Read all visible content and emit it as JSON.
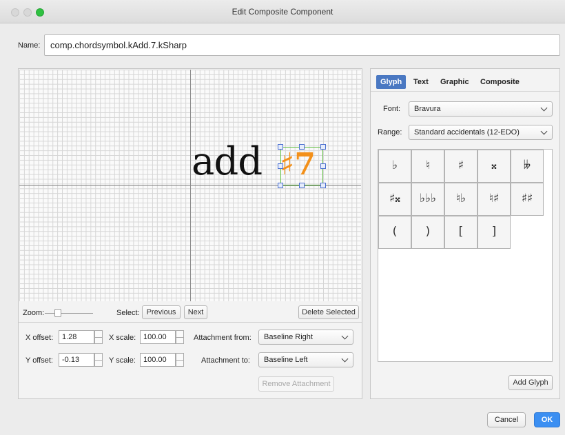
{
  "window": {
    "title": "Edit Composite Component"
  },
  "name_field": {
    "label": "Name:",
    "value": "comp.chordsymbol.kAdd.7.kSharp"
  },
  "canvas": {
    "text": "add",
    "selected_glyph": "♯7"
  },
  "toolbar": {
    "zoom_label": "Zoom:",
    "select_label": "Select:",
    "previous": "Previous",
    "next": "Next",
    "delete_selected": "Delete Selected"
  },
  "properties": {
    "x_offset_label": "X offset:",
    "x_offset": "1.28",
    "y_offset_label": "Y offset:",
    "y_offset": "-0.13",
    "x_scale_label": "X scale:",
    "x_scale": "100.00",
    "y_scale_label": "Y scale:",
    "y_scale": "100.00",
    "attach_from_label": "Attachment from:",
    "attach_from": "Baseline Right",
    "attach_to_label": "Attachment to:",
    "attach_to": "Baseline Left",
    "remove_attachment": "Remove Attachment"
  },
  "tabs": [
    "Glyph",
    "Text",
    "Graphic",
    "Composite"
  ],
  "glyph_panel": {
    "font_label": "Font:",
    "font": "Bravura",
    "range_label": "Range:",
    "range": "Standard accidentals (12-EDO)",
    "glyphs": [
      "♭",
      "♮",
      "♯",
      "𝄪",
      "𝄫",
      "♯𝄪",
      "♭♭♭",
      "♮♭",
      "♮♯",
      "♯♯",
      "(",
      ")",
      "[",
      "]"
    ],
    "add_glyph": "Add Glyph"
  },
  "footer": {
    "cancel": "Cancel",
    "ok": "OK"
  },
  "colors": {
    "accent": "#4a78c2",
    "selection_orange": "#f39019",
    "ok_blue": "#3b8ff2"
  }
}
